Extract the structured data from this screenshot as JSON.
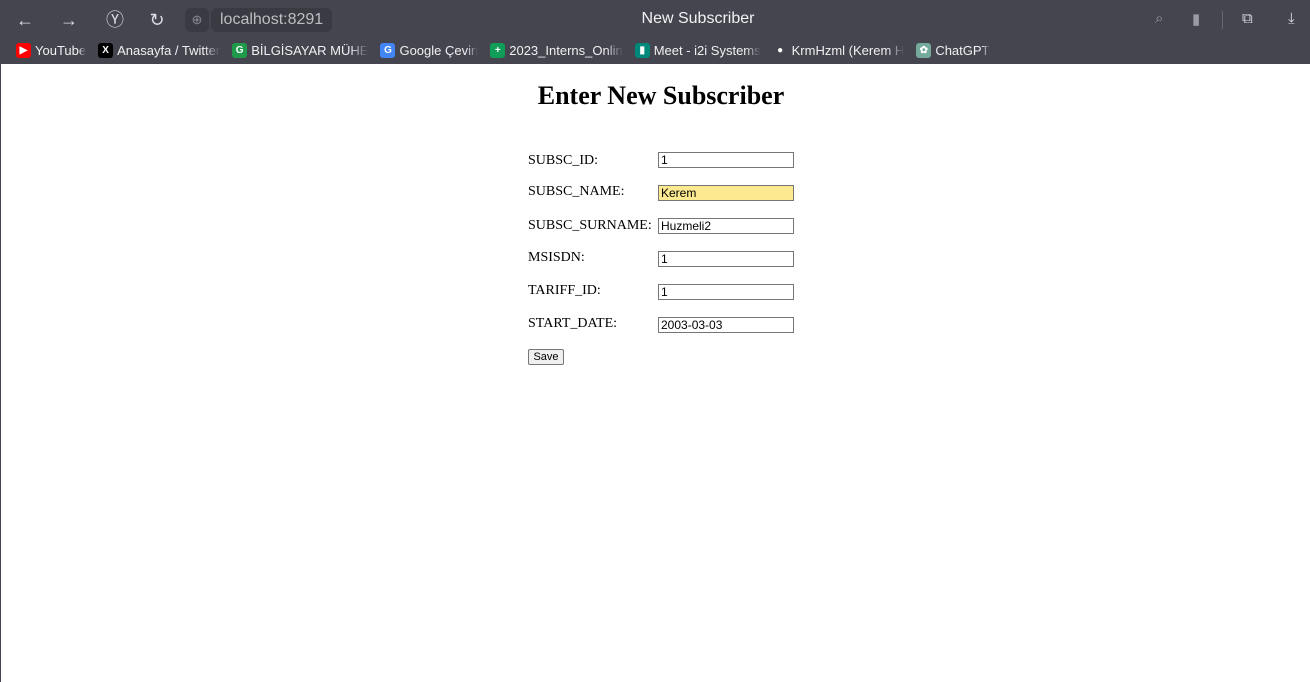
{
  "browser": {
    "url": "localhost:8291",
    "tab_title": "New Subscriber",
    "bookmarks": [
      {
        "label": "YouTube",
        "color": "#ff0000",
        "glyph": "▶"
      },
      {
        "label": "Anasayfa / Twitter",
        "color": "#000000",
        "glyph": "X"
      },
      {
        "label": "BİLGİSAYAR MÜHE",
        "color": "#1e9a4a",
        "glyph": "G"
      },
      {
        "label": "Google Çeviri",
        "color": "#4285f4",
        "glyph": "G"
      },
      {
        "label": "2023_Interns_Onlin",
        "color": "#0f9d58",
        "glyph": "+"
      },
      {
        "label": "Meet - i2i Systems",
        "color": "#00897b",
        "glyph": "▮"
      },
      {
        "label": "KrmHzml (Kerem H",
        "color": "#45454f",
        "glyph": "●"
      },
      {
        "label": "ChatGPT",
        "color": "#74aa9c",
        "glyph": "✿"
      }
    ]
  },
  "page": {
    "heading": "Enter New Subscriber",
    "fields": [
      {
        "label": "SUBSC_ID:",
        "value": "1"
      },
      {
        "label": "SUBSC_NAME:",
        "value": "Kerem",
        "autofill": true
      },
      {
        "label": "SUBSC_SURNAME:",
        "value": "Huzmeli2"
      },
      {
        "label": "MSISDN:",
        "value": "1"
      },
      {
        "label": "TARIFF_ID:",
        "value": "1"
      },
      {
        "label": "START_DATE:",
        "value": "2003-03-03"
      }
    ],
    "save_label": "Save",
    "autofill_color": "#fde98f"
  }
}
